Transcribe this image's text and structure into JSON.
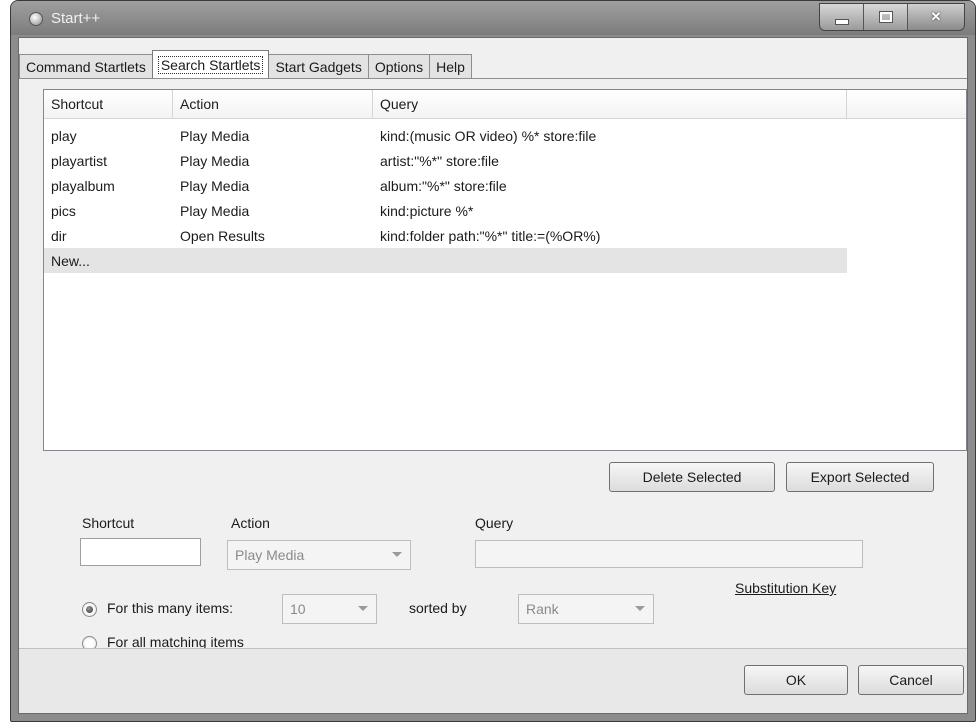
{
  "window": {
    "title": "Start++"
  },
  "tabs": [
    {
      "label": "Command Startlets",
      "active": false
    },
    {
      "label": "Search Startlets",
      "active": true
    },
    {
      "label": "Start Gadgets",
      "active": false
    },
    {
      "label": "Options",
      "active": false
    },
    {
      "label": "Help",
      "active": false
    }
  ],
  "list": {
    "columns": [
      "Shortcut",
      "Action",
      "Query"
    ],
    "rows": [
      {
        "shortcut": "play",
        "action": "Play Media",
        "query": "kind:(music OR video) %* store:file"
      },
      {
        "shortcut": "playartist",
        "action": "Play Media",
        "query": "artist:\"%*\" store:file"
      },
      {
        "shortcut": "playalbum",
        "action": "Play Media",
        "query": "album:\"%*\" store:file"
      },
      {
        "shortcut": "pics",
        "action": "Play Media",
        "query": "kind:picture %*"
      },
      {
        "shortcut": "dir",
        "action": "Open Results",
        "query": "kind:folder path:\"%*\" title:=(%OR%)"
      }
    ],
    "new_row_label": "New..."
  },
  "buttons": {
    "delete_selected": "Delete Selected",
    "export_selected": "Export Selected",
    "ok": "OK",
    "cancel": "Cancel"
  },
  "form": {
    "shortcut_label": "Shortcut",
    "shortcut_value": "",
    "action_label": "Action",
    "action_value": "Play Media",
    "query_label": "Query",
    "query_value": "",
    "substitution_key": "Substitution Key",
    "radio_this_many": "For this many items:",
    "count_value": "10",
    "sorted_by_label": "sorted by",
    "sort_value": "Rank",
    "radio_all": "For all matching items"
  }
}
